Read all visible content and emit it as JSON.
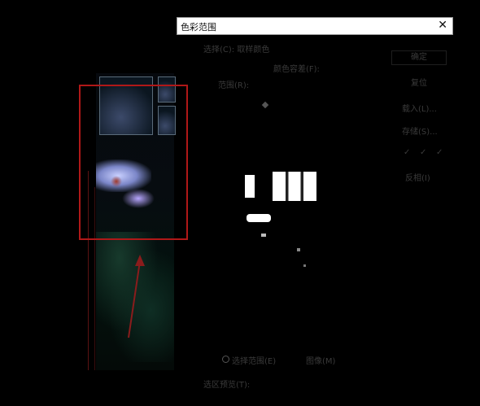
{
  "dialog": {
    "title": "色彩范围",
    "close_glyph": "✕"
  },
  "select_label": "选择(C): 取样颜色",
  "fuzziness_label": "颜色容差(F):",
  "range_label": "范围(R):",
  "buttons": {
    "ok": "确定",
    "reset": "复位",
    "load": "载入(L)...",
    "save": "存储(S)...",
    "eyedroppers": [
      "✓",
      "✓",
      "✓"
    ],
    "invert": "反相(I)"
  },
  "preview_options": {
    "selection": "选择范围(E)",
    "image": "图像(M)"
  },
  "selection_preview": "选区预览(T):",
  "colors": {
    "annotation_red": "#b01818",
    "arrow": "#8a1c1c"
  }
}
